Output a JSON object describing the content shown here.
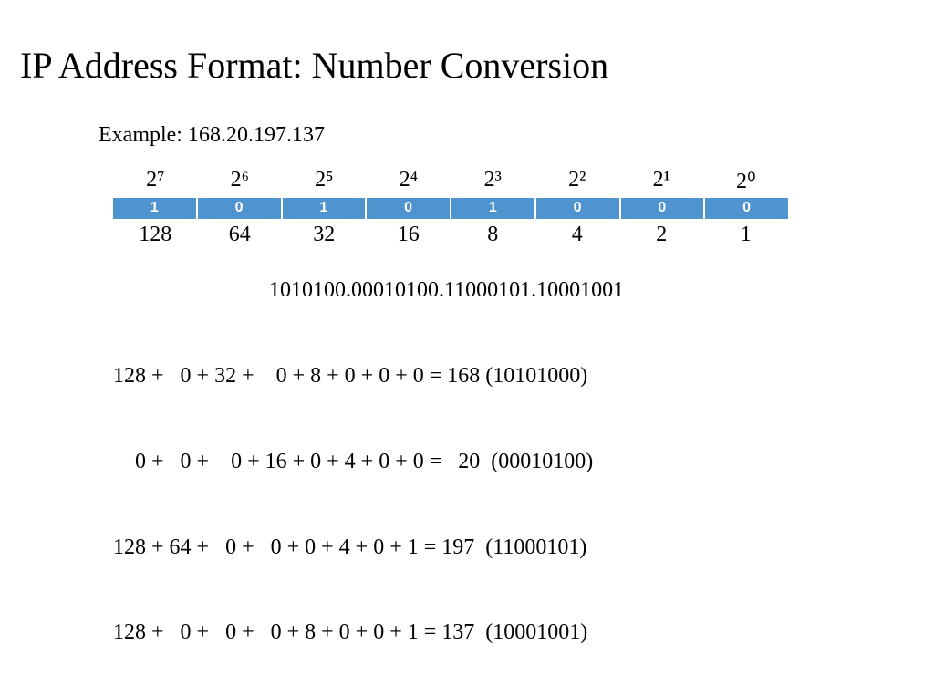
{
  "title": "IP Address Format: Number Conversion",
  "example_label": "Example: 168.20.197.137",
  "table": {
    "powers": [
      "2⁷",
      "2⁶",
      "2⁵",
      "2⁴",
      "2³",
      "2²",
      "2¹",
      "2⁰"
    ],
    "bits": [
      "1",
      "0",
      "1",
      "0",
      "1",
      "0",
      "0",
      "0"
    ],
    "values": [
      "128",
      "64",
      "32",
      "16",
      "8",
      "4",
      "2",
      "1"
    ]
  },
  "binary_string": "1010100.00010100.11000101.10001001",
  "calculations": [
    "128 +   0 + 32 +    0 + 8 + 0 + 0 + 0 = 168 (10101000)",
    "    0 +   0 +    0 + 16 + 0 + 4 + 0 + 0 =   20  (00010100)",
    "128 + 64 +   0 +   0 + 0 + 4 + 0 + 1 = 197  (11000101)",
    "128 +   0 +   0 +   0 + 8 + 0 + 0 + 1 = 137  (10001001)"
  ]
}
